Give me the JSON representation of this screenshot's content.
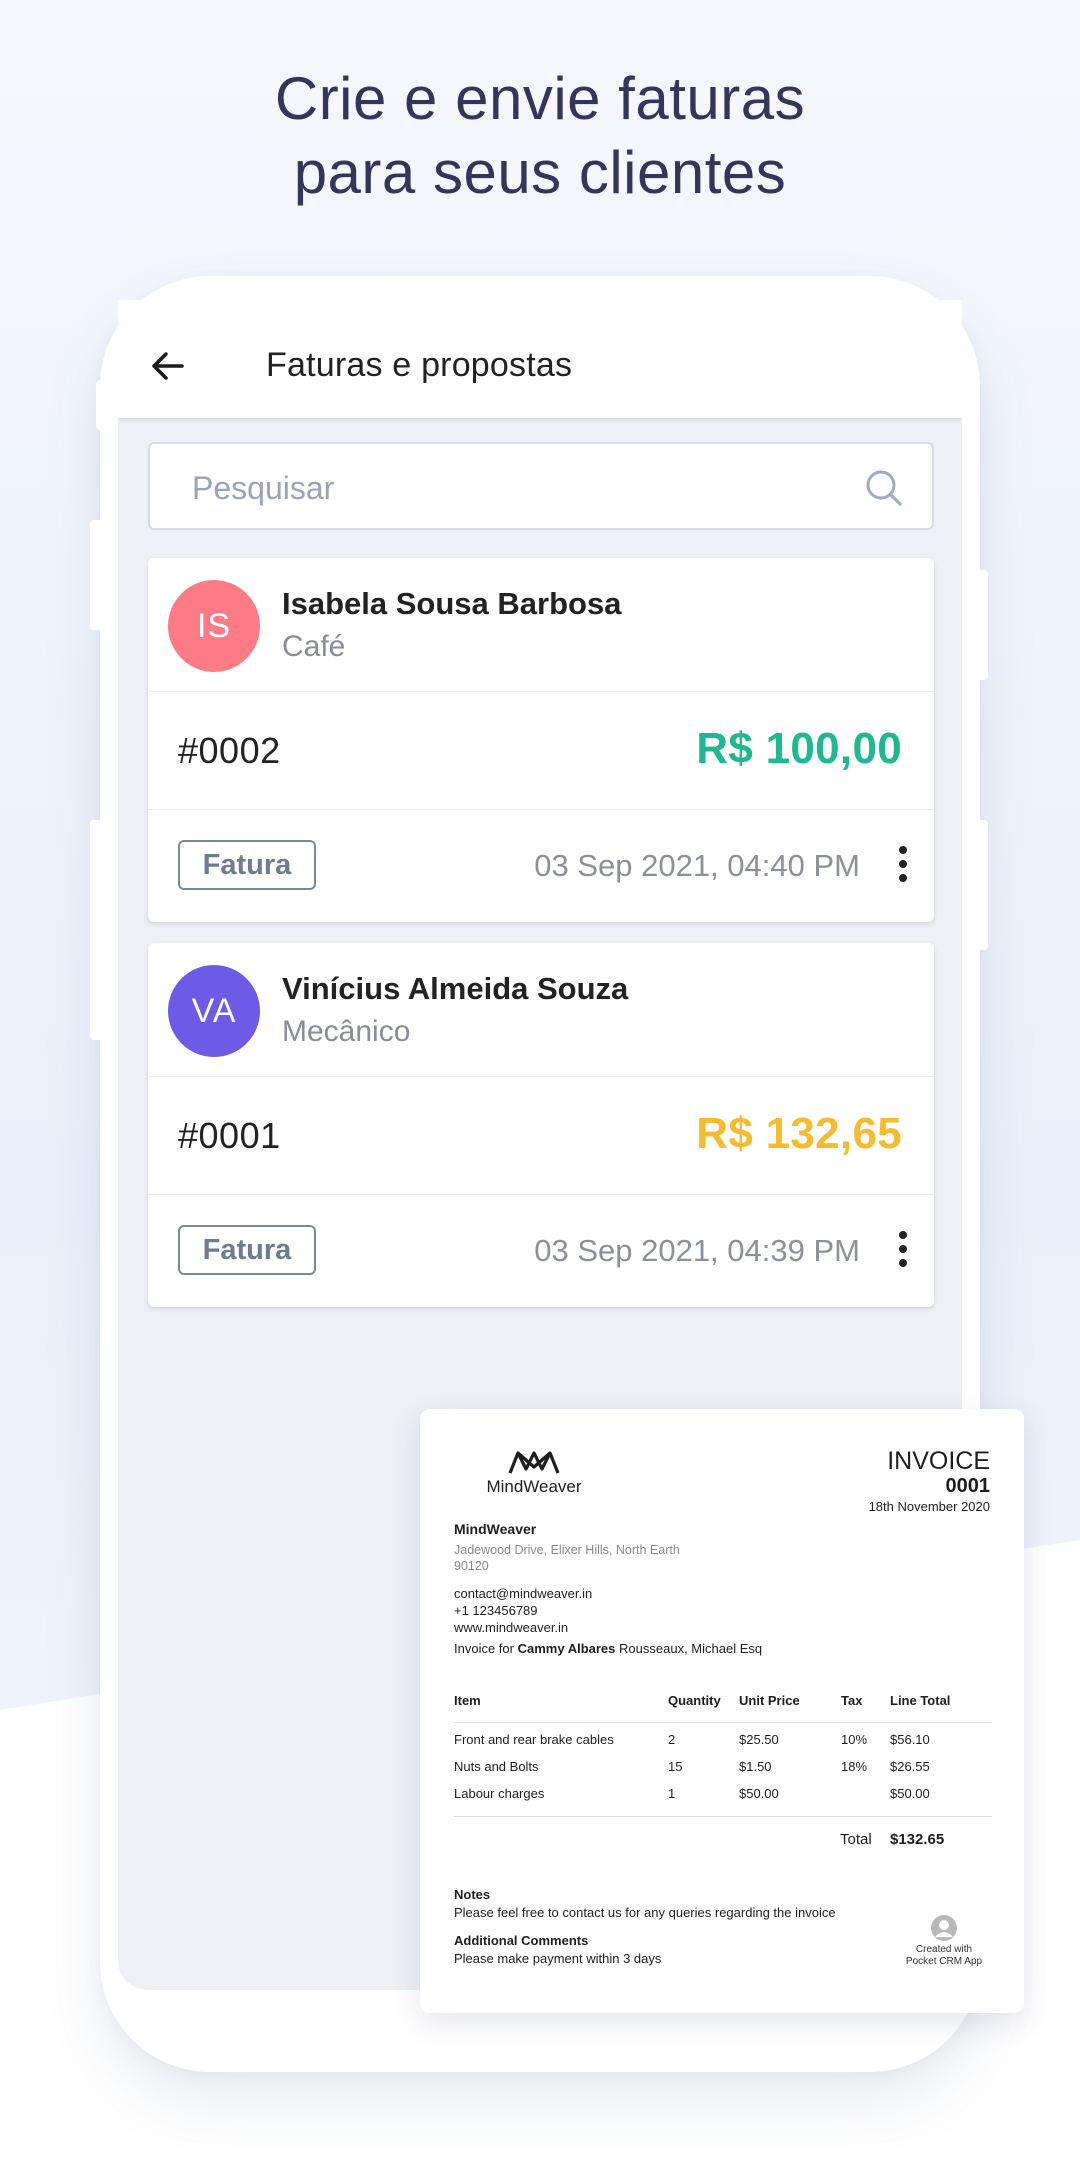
{
  "headline": {
    "line1": "Crie e envie faturas",
    "line2": "para seus clientes"
  },
  "appbar": {
    "back_icon": "arrow-left-icon",
    "title": "Faturas e propostas"
  },
  "search": {
    "placeholder": "Pesquisar",
    "icon": "search-icon"
  },
  "invoices": [
    {
      "initials": "IS",
      "avatar_color": "#fc7b86",
      "client": "Isabela Sousa Barbosa",
      "category": "Café",
      "number": "#0002",
      "amount": "R$ 100,00",
      "amount_color": "#1db98f",
      "type": "Fatura",
      "date": "03 Sep 2021, 04:40 PM"
    },
    {
      "initials": "VA",
      "avatar_color": "#6e5ae6",
      "client": "Vinícius Almeida Souza",
      "category": "Mecânico",
      "number": "#0001",
      "amount": "R$ 132,65",
      "amount_color": "#f7bb2e",
      "type": "Fatura",
      "date": "03 Sep 2021, 04:39 PM"
    }
  ],
  "invoice_doc": {
    "logo_text": "MindWeaver",
    "title": "INVOICE",
    "number": "0001",
    "date": "18th November 2020",
    "company": "MindWeaver",
    "address": "Jadewood Drive, Elixer Hills, North Earth 90120",
    "email": "contact@mindweaver.in",
    "phone": "+1 123456789",
    "website": "www.mindweaver.in",
    "invoice_for_prefix": "Invoice for",
    "invoice_for_name": "Cammy Albares",
    "invoice_for_rest": "Rousseaux, Michael Esq",
    "columns": [
      "Item",
      "Quantity",
      "Unit Price",
      "Tax",
      "Line Total"
    ],
    "rows": [
      [
        "Front and rear brake cables",
        "2",
        "$25.50",
        "10%",
        "$56.10"
      ],
      [
        "Nuts and Bolts",
        "15",
        "$1.50",
        "18%",
        "$26.55"
      ],
      [
        "Labour charges",
        "1",
        "$50.00",
        "",
        "$50.00"
      ]
    ],
    "total_label": "Total",
    "total_value": "$132.65",
    "notes_heading": "Notes",
    "notes": "Please feel free to contact us for any queries regarding the invoice",
    "comments_heading": "Additional Comments",
    "comments": "Please make payment within 3 days",
    "created_with_line1": "Created with",
    "created_with_line2": "Pocket CRM App"
  }
}
